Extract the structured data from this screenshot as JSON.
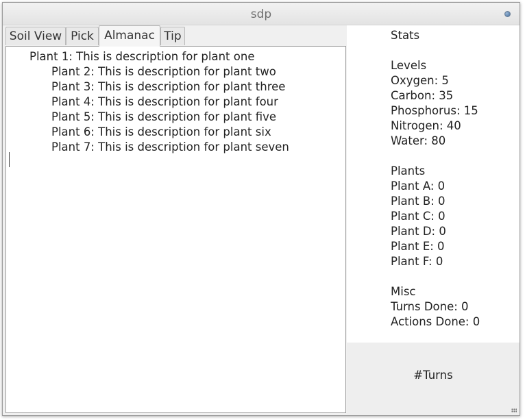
{
  "window": {
    "title": "sdp"
  },
  "tabs": [
    {
      "label": "Soil View",
      "active": false
    },
    {
      "label": "Pick",
      "active": false
    },
    {
      "label": "Almanac",
      "active": true
    },
    {
      "label": "Tip",
      "active": false
    }
  ],
  "almanac": {
    "items": [
      "Plant 1: This is description for plant one",
      "Plant 2: This is description for plant two",
      "Plant 3: This is description for plant three",
      "Plant 4: This is description for plant four",
      "Plant 5: This is description for plant five",
      "Plant 6: This is description for plant six",
      "Plant 7: This is description for plant seven"
    ]
  },
  "stats": {
    "header": "Stats",
    "levels": {
      "header": "Levels",
      "oxygen": "Oxygen: 5",
      "carbon": "Carbon: 35",
      "phosphorus": "Phosphorus: 15",
      "nitrogen": "Nitrogen: 40",
      "water": "Water: 80"
    },
    "plants": {
      "header": "Plants",
      "a": "Plant A: 0",
      "b": "Plant B: 0",
      "c": "Plant C: 0",
      "d": "Plant D: 0",
      "e": "Plant E: 0",
      "f": "Plant F: 0"
    },
    "misc": {
      "header": "Misc",
      "turns_done": "Turns Done: 0",
      "actions_done": "Actions Done: 0"
    }
  },
  "turns": {
    "label": "#Turns"
  }
}
